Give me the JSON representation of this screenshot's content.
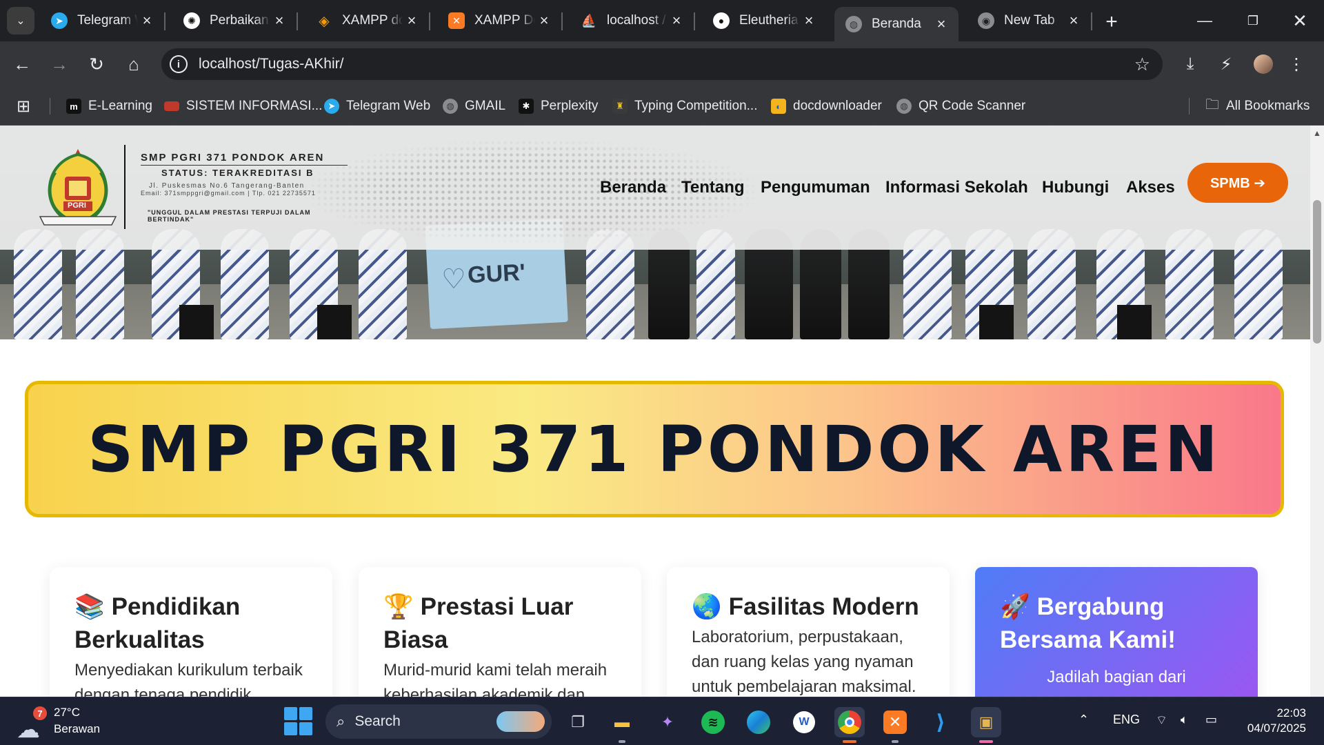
{
  "browser": {
    "tabs": [
      {
        "title": "Telegram W",
        "icon": "telegram-icon",
        "color": "#2aabee"
      },
      {
        "title": "Perbaikan",
        "icon": "chatgpt-icon",
        "color": "#202124"
      },
      {
        "title": "XAMPP do",
        "icon": "xampp-diamond-icon",
        "color": "#f59b00"
      },
      {
        "title": "XAMPP Do",
        "icon": "xampp-icon",
        "color": "#fb7a24"
      },
      {
        "title": "localhost /",
        "icon": "phpmyadmin-icon",
        "color": "#f29111"
      },
      {
        "title": "Eleutheria",
        "icon": "github-icon",
        "color": "#202124"
      },
      {
        "title": "Beranda",
        "icon": "globe-icon",
        "color": "#5f6368",
        "active": true
      },
      {
        "title": "New Tab",
        "icon": "chrome-icon",
        "color": "#5f6368"
      }
    ],
    "url": "localhost/Tugas-AKhir/",
    "bookmarks": [
      {
        "label": "E-Learning",
        "icon": "moodle-icon",
        "color": "#111111",
        "glyph": "m"
      },
      {
        "label": "SISTEM INFORMASI...",
        "icon": "siakad-icon",
        "color": "#c0392b",
        "glyph": ""
      },
      {
        "label": "Telegram Web",
        "icon": "telegram-icon",
        "color": "#2aabee",
        "glyph": "➤"
      },
      {
        "label": "GMAIL",
        "icon": "globe-icon",
        "color": "#5f6368",
        "glyph": "◍"
      },
      {
        "label": "Perplexity",
        "icon": "perplexity-icon",
        "color": "#111111",
        "glyph": "✱"
      },
      {
        "label": "Typing Competition...",
        "icon": "trophy-icon",
        "color": "#3a3a3a",
        "glyph": "♜"
      },
      {
        "label": "docdownloader",
        "icon": "docdownloader-icon",
        "color": "#f3b51b",
        "glyph": "◐"
      },
      {
        "label": "QR Code Scanner",
        "icon": "globe-icon",
        "color": "#5f6368",
        "glyph": "◍"
      }
    ],
    "all_bookmarks": "All Bookmarks"
  },
  "site": {
    "school_name": "SMP PGRI 371 PONDOK AREN",
    "status": "STATUS: TERAKREDITASI B",
    "address": "Jl. Puskesmas No.6 Tangerang-Banten",
    "contact": "Email: 371smppgri@gmail.com | Tlp. 021 22735571",
    "motto": "\"UNGGUL DALAM PRESTASI TERPUJI DALAM BERTINDAK\"",
    "logo_text": "PGRI",
    "menu": [
      "Beranda",
      "Tentang",
      "Pengumuman",
      "Informasi Sekolah",
      "Hubungi",
      "Akses"
    ],
    "cta": "SPMB ➔",
    "hero_sign": "GUR'",
    "banner": "SMP PGRI 371 PONDOK AREN",
    "cards": [
      {
        "emoji": "📚",
        "title": "Pendidikan Berkualitas",
        "text": "Menyediakan kurikulum terbaik dengan tenaga pendidik"
      },
      {
        "emoji": "🏆",
        "title": "Prestasi Luar Biasa",
        "text": "Murid-murid kami telah meraih keberhasilan akademik dan"
      },
      {
        "emoji": "🌏",
        "title": "Fasilitas Modern",
        "text": "Laboratorium, perpustakaan, dan ruang kelas yang nyaman untuk pembelajaran maksimal."
      },
      {
        "emoji": "🚀",
        "title": "Bergabung Bersama Kami!",
        "text": "Jadilah bagian dari"
      }
    ]
  },
  "taskbar": {
    "weather_temp": "27°C",
    "weather_desc": "Berawan",
    "weather_badge": "7",
    "search": "Search",
    "lang": "ENG",
    "time": "22:03",
    "date": "04/07/2025"
  },
  "colors": {
    "accent": "#e8650a",
    "banner_border": "#e6b800",
    "join_card": "#4f7cf7"
  }
}
